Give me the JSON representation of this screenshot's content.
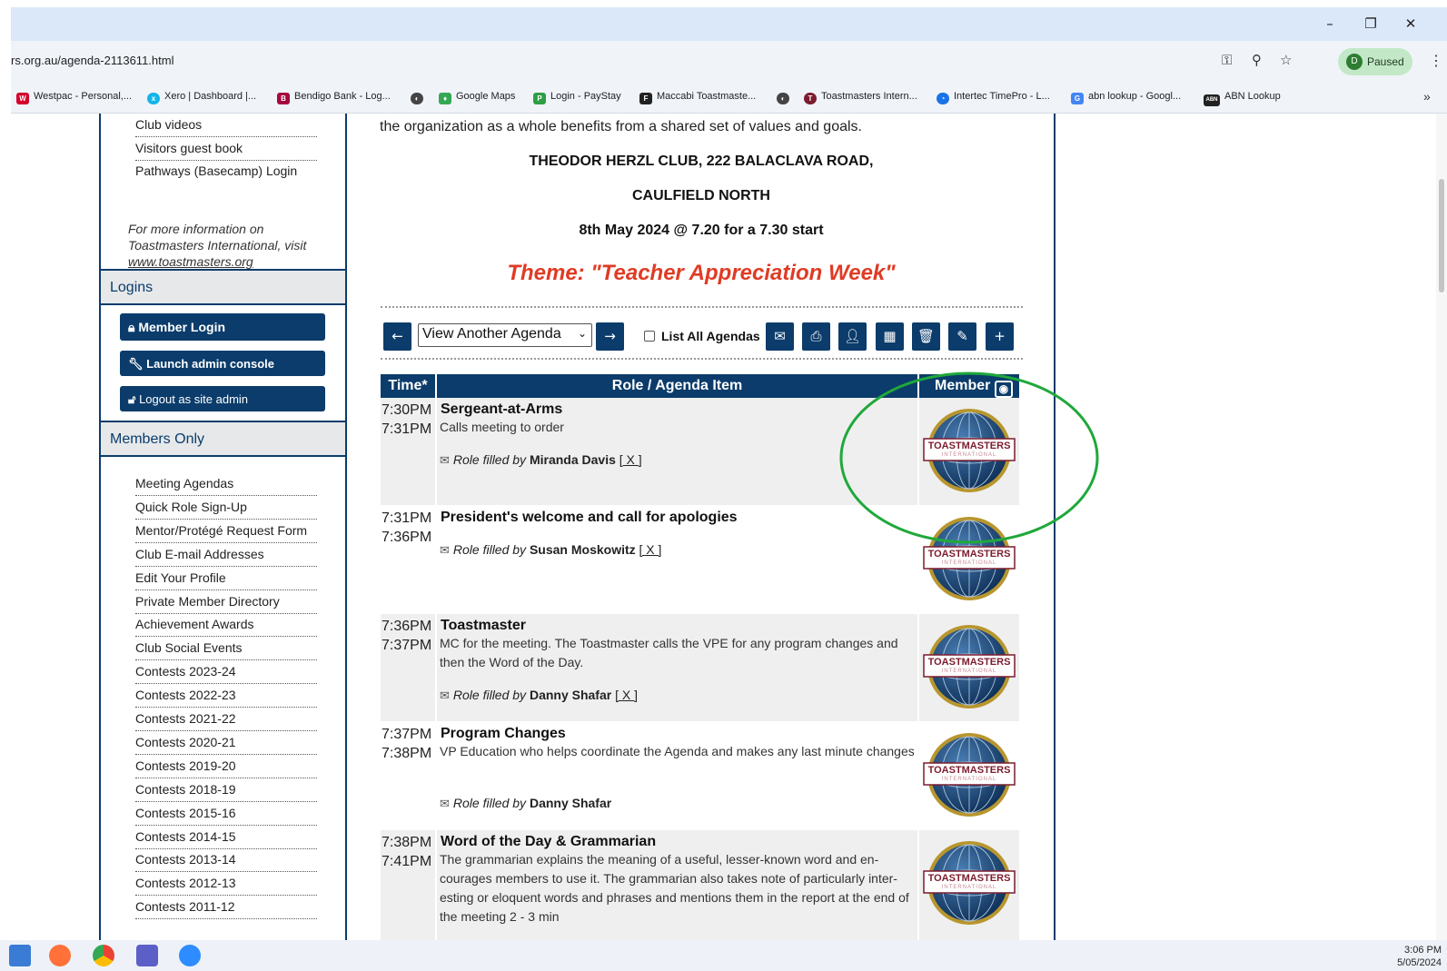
{
  "browser": {
    "url": "rs.org.au/agenda-2113611.html",
    "profile_initial": "D",
    "profile_status": "Paused",
    "window_buttons": [
      "–",
      "❐",
      "✕"
    ],
    "bookmarks_overflow": "»"
  },
  "bookmarks": [
    {
      "label": "Westpac - Personal,...",
      "color": "#d5002b",
      "glyph": "W"
    },
    {
      "label": "Xero | Dashboard |...",
      "color": "#13b5ea",
      "glyph": "x"
    },
    {
      "label": "Bendigo Bank - Log...",
      "color": "#a6093d",
      "glyph": "B"
    },
    {
      "label": "",
      "color": "#444444",
      "glyph": "◐"
    },
    {
      "label": "Google Maps",
      "color": "#34a853",
      "glyph": "♦"
    },
    {
      "label": "Login - PayStay",
      "color": "#2e9e45",
      "glyph": "P"
    },
    {
      "label": "Maccabi Toastmaste...",
      "color": "#222222",
      "glyph": "F"
    },
    {
      "label": "",
      "color": "#444444",
      "glyph": "◐"
    },
    {
      "label": "Toastmasters Intern...",
      "color": "#7b1c2e",
      "glyph": "T"
    },
    {
      "label": "Intertec TimePro - L...",
      "color": "#1a73e8",
      "glyph": "◔"
    },
    {
      "label": "abn lookup - Googl...",
      "color": "#4285f4",
      "glyph": "G"
    },
    {
      "label": "ABN Lookup",
      "color": "#222222",
      "glyph": "ABN"
    }
  ],
  "sidebar": {
    "top_links": [
      "Club videos",
      "Visitors guest book",
      "Pathways (Basecamp) Login"
    ],
    "info_text": "For more information on Toastmasters International, visit",
    "info_link": "www.toastmasters.org",
    "logins_heading": "Logins",
    "buttons": [
      "Member Login",
      "Launch admin console",
      "Logout as site admin"
    ],
    "members_heading": "Members Only",
    "member_links": [
      "Meeting Agendas",
      "Quick Role Sign-Up",
      "Mentor/Protégé Request Form",
      "Club E-mail Addresses",
      "Edit Your Profile",
      "Private Member Directory",
      "Achievement Awards",
      "Club Social Events",
      "Contests 2023-24",
      "Contests 2022-23",
      "Contests 2021-22",
      "Contests 2020-21",
      "Contests 2019-20",
      "Contests 2018-19",
      "Contests 2015-16",
      "Contests 2014-15",
      "Contests 2013-14",
      "Contests 2012-13",
      "Contests 2011-12"
    ]
  },
  "main": {
    "intro_line": "the organization as a whole benefits from a shared set of values and goals.",
    "venue_line1": "THEODOR HERZL CLUB, 222 BALACLAVA ROAD,",
    "venue_line2": "CAULFIELD NORTH",
    "date_line": "8th May 2024 @ 7.20 for a 7.30 start",
    "theme": "Theme: \"Teacher Appreciation Week\"",
    "agenda_select": "View Another Agenda",
    "list_all_label": "List All Agendas",
    "table_headers": {
      "time": "Time*",
      "role": "Role / Agenda Item",
      "member": "Member"
    },
    "role_filled_label": "Role filled by",
    "remove_label": "[ X ]",
    "logo_text": "TOASTMASTERS",
    "logo_subtext": "INTERNATIONAL",
    "rows": [
      {
        "start": "7:30PM",
        "end": "7:31PM",
        "role": "Sergeant-at-Arms",
        "desc": "Calls meeting to order",
        "member": "Miranda Davis",
        "removable": true
      },
      {
        "start": "7:31PM",
        "end": "7:36PM",
        "role": "President's welcome and call for apologies",
        "desc": "",
        "member": "Susan Moskowitz",
        "removable": true
      },
      {
        "start": "7:36PM",
        "end": "7:37PM",
        "role": "Toastmaster",
        "desc": "MC for the meeting. The Toastmaster calls the VPE for any program changes and then the Word of the Day.",
        "member": "Danny Shafar",
        "removable": true
      },
      {
        "start": "7:37PM",
        "end": "7:38PM",
        "role": "Program Changes",
        "desc": "VP Education who helps coordinate the Agenda and makes any last minute changes",
        "member": "Danny Shafar",
        "removable": false
      },
      {
        "start": "7:38PM",
        "end": "7:41PM",
        "role": "Word of the Day & Grammarian",
        "desc": "The grammarian explains the meaning of a useful, lesser-known word and en-courages members to use it. The grammarian also takes note of particularly inter-esting or eloquent words and phrases and mentions them in the report at the end of the meeting 2 - 3 min",
        "member": "",
        "removable": false
      }
    ]
  },
  "taskbar": {
    "time": "3:06 PM",
    "date": "5/05/2024"
  },
  "colors": {
    "brand_navy": "#0b3c6b",
    "theme_red": "#e03b24",
    "annotation_green": "#1fa83b"
  }
}
